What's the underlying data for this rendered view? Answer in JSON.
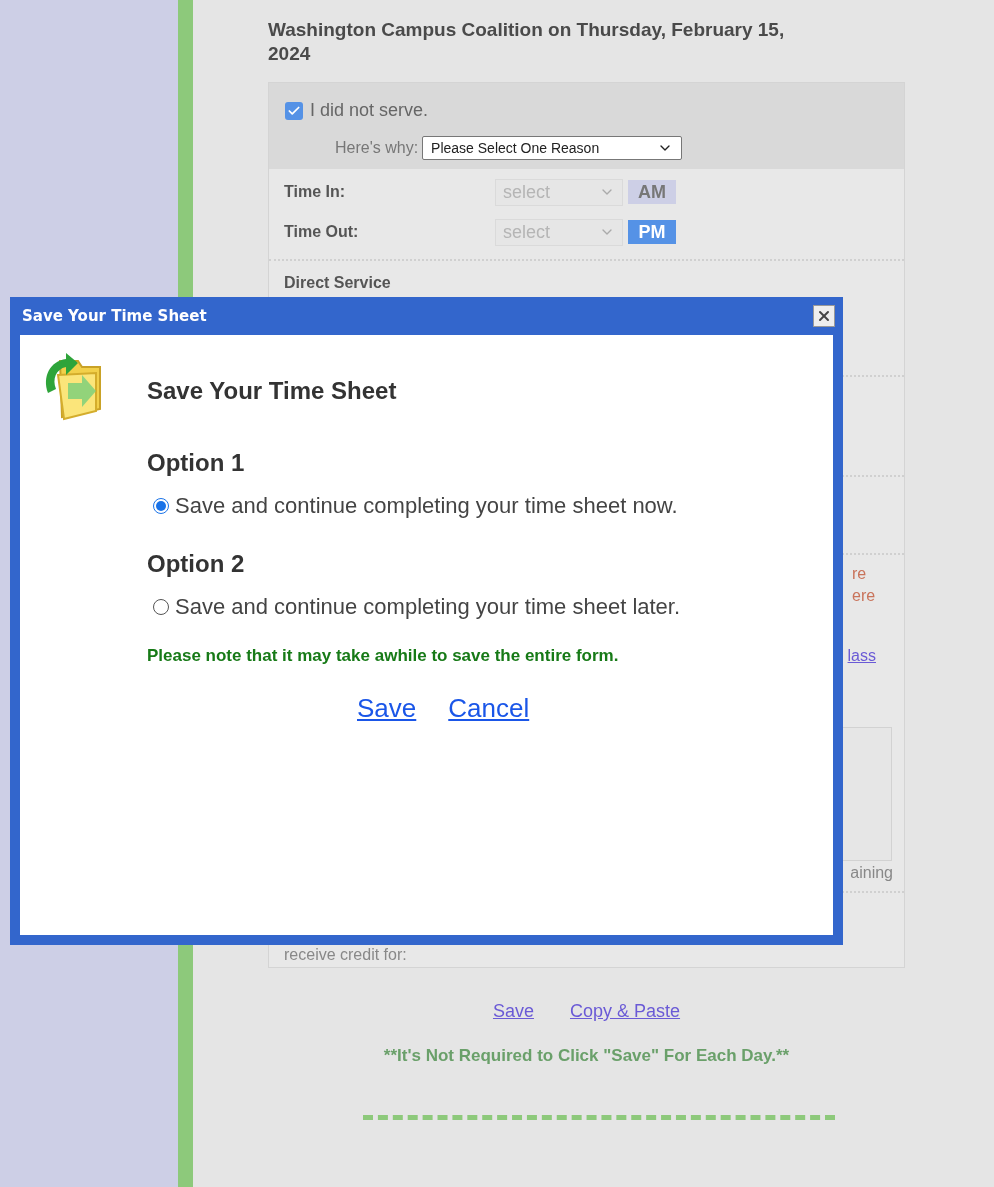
{
  "page_title": "Washington Campus Coalition on Thursday, February 15, 2024",
  "did_not_serve": {
    "label": "I did not serve.",
    "checked": true
  },
  "reason": {
    "label": "Here's why:",
    "value": "Please Select One Reason"
  },
  "time_rows": [
    {
      "label": "Time In:",
      "value": "select",
      "meridiem": {
        "text": "AM",
        "selected": false
      }
    },
    {
      "label": "Time Out:",
      "value": "select",
      "meridiem": {
        "text": "PM",
        "selected": true
      }
    }
  ],
  "section_heading": "Direct Service",
  "partial_texts": [
    {
      "text": "re",
      "kind": "warning"
    },
    {
      "text": "ere",
      "kind": "warning"
    },
    {
      "text": "lass",
      "kind": "link"
    }
  ],
  "textarea_counter": "aining",
  "credit_text": "receive credit for:",
  "footer_links": [
    "Save",
    "Copy & Paste"
  ],
  "footer_note": "**It's Not Required to Click \"Save\" For Each Day.**",
  "dialog": {
    "title": "Save Your Time Sheet",
    "heading": "Save Your Time Sheet",
    "options": [
      {
        "heading": "Option 1",
        "label": "Save and continue completing your time sheet now.",
        "selected": true
      },
      {
        "heading": "Option 2",
        "label": "Save and continue completing your time sheet later.",
        "selected": false
      }
    ],
    "note": "Please note that it may take awhile to save the entire form.",
    "actions": [
      "Save",
      "Cancel"
    ]
  }
}
